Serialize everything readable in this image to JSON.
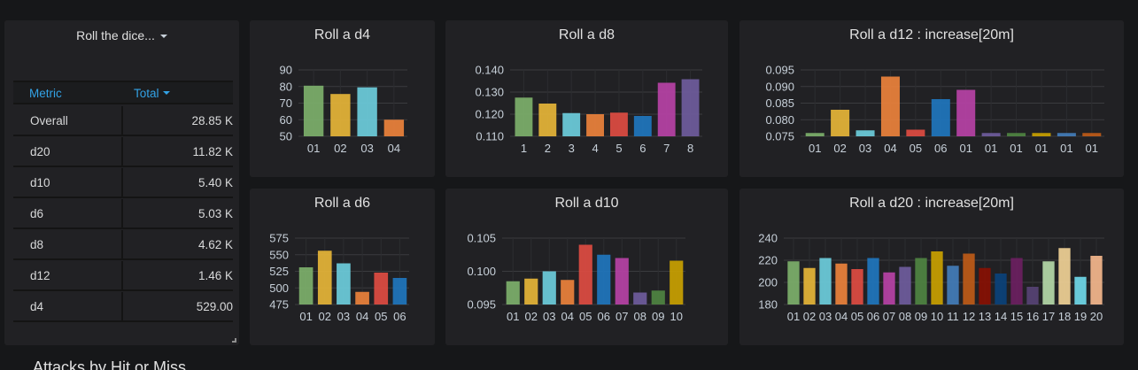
{
  "table_panel": {
    "title": "Roll the dice...",
    "columns": [
      "Metric",
      "Total"
    ],
    "rows": [
      {
        "metric": "Overall",
        "total": "28.85 K"
      },
      {
        "metric": "d20",
        "total": "11.82 K"
      },
      {
        "metric": "d10",
        "total": "5.40 K"
      },
      {
        "metric": "d6",
        "total": "5.03 K"
      },
      {
        "metric": "d8",
        "total": "4.62 K"
      },
      {
        "metric": "d12",
        "total": "1.46 K"
      },
      {
        "metric": "d4",
        "total": "529.00"
      }
    ]
  },
  "section_title": "Attacks by Hit or Miss",
  "chart_data": [
    {
      "id": "d4",
      "type": "bar",
      "title": "Roll a d4",
      "categories": [
        "01",
        "02",
        "03",
        "04"
      ],
      "values": [
        80.5,
        75.5,
        79.5,
        60
      ],
      "colors": [
        "#7eb26d",
        "#eab839",
        "#6ed0e0",
        "#ef843c"
      ],
      "ylim": [
        50,
        90
      ],
      "yticks": [
        "50",
        "60",
        "70",
        "80",
        "90"
      ]
    },
    {
      "id": "d8",
      "type": "bar",
      "title": "Roll a d8",
      "categories": [
        "1",
        "2",
        "3",
        "4",
        "5",
        "6",
        "7",
        "8"
      ],
      "values": [
        0.1275,
        0.1248,
        0.1205,
        0.12,
        0.1207,
        0.1192,
        0.1342,
        0.1358
      ],
      "colors": [
        "#7eb26d",
        "#eab839",
        "#6ed0e0",
        "#ef843c",
        "#e24d42",
        "#1f78c1",
        "#ba43a9",
        "#705da0"
      ],
      "ylim": [
        0.11,
        0.14
      ],
      "yticks": [
        "0.110",
        "0.120",
        "0.130",
        "0.140"
      ]
    },
    {
      "id": "d12",
      "type": "bar",
      "title": "Roll a d12 : increase[20m]",
      "categories": [
        "01",
        "02",
        "03",
        "04",
        "05",
        "06",
        "01",
        "01",
        "01",
        "01",
        "01",
        "01"
      ],
      "values": [
        0.076,
        0.083,
        0.0768,
        0.093,
        0.077,
        0.0862,
        0.089,
        0.076,
        0.076,
        0.076,
        0.076,
        0.076
      ],
      "colors": [
        "#7eb26d",
        "#eab839",
        "#6ed0e0",
        "#ef843c",
        "#e24d42",
        "#1f78c1",
        "#ba43a9",
        "#705da0",
        "#508642",
        "#cca300",
        "#447ebc",
        "#c15c17"
      ],
      "ylim": [
        0.075,
        0.095
      ],
      "yticks": [
        "0.075",
        "0.080",
        "0.085",
        "0.090",
        "0.095"
      ]
    },
    {
      "id": "d6",
      "type": "bar",
      "title": "Roll a d6",
      "categories": [
        "01",
        "02",
        "03",
        "04",
        "05",
        "06"
      ],
      "values": [
        531,
        556,
        537,
        494,
        523,
        515
      ],
      "colors": [
        "#7eb26d",
        "#eab839",
        "#6ed0e0",
        "#ef843c",
        "#e24d42",
        "#1f78c1"
      ],
      "ylim": [
        475,
        575
      ],
      "yticks": [
        "475",
        "500",
        "525",
        "550",
        "575"
      ]
    },
    {
      "id": "d10",
      "type": "bar",
      "title": "Roll a d10",
      "categories": [
        "01",
        "02",
        "03",
        "04",
        "05",
        "06",
        "07",
        "08",
        "09",
        "10"
      ],
      "values": [
        0.0985,
        0.0989,
        0.1,
        0.0987,
        0.104,
        0.1025,
        0.102,
        0.0968,
        0.0971,
        0.1016
      ],
      "colors": [
        "#7eb26d",
        "#eab839",
        "#6ed0e0",
        "#ef843c",
        "#e24d42",
        "#1f78c1",
        "#ba43a9",
        "#705da0",
        "#508642",
        "#cca300"
      ],
      "ylim": [
        0.095,
        0.105
      ],
      "yticks": [
        "0.095",
        "0.100",
        "0.105"
      ]
    },
    {
      "id": "d20",
      "type": "bar",
      "title": "Roll a d20 : increase[20m]",
      "categories": [
        "01",
        "02",
        "03",
        "04",
        "05",
        "06",
        "07",
        "08",
        "09",
        "10",
        "11",
        "12",
        "13",
        "14",
        "15",
        "16",
        "17",
        "18",
        "19",
        "20"
      ],
      "values": [
        219,
        213,
        222,
        217,
        212,
        222,
        209,
        214,
        222,
        228,
        215,
        226,
        213,
        208,
        222,
        196,
        219,
        231,
        205,
        224
      ],
      "colors": [
        "#7eb26d",
        "#eab839",
        "#6ed0e0",
        "#ef843c",
        "#e24d42",
        "#1f78c1",
        "#ba43a9",
        "#705da0",
        "#508642",
        "#cca300",
        "#447ebc",
        "#c15c17",
        "#890f02",
        "#0a437c",
        "#6d1f62",
        "#584477",
        "#b7dbab",
        "#f4d598",
        "#70dbed",
        "#f9ba8f"
      ],
      "ylim": [
        180,
        240
      ],
      "yticks": [
        "180",
        "200",
        "220",
        "240"
      ]
    }
  ]
}
